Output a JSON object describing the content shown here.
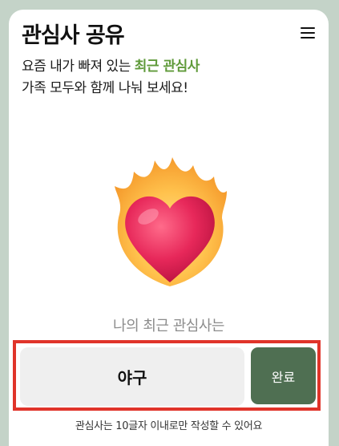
{
  "header": {
    "title": "관심사 공유",
    "menu_icon": "hamburger-menu-icon"
  },
  "intro": {
    "line1_prefix": "요즘 내가 빠져 있는 ",
    "line1_highlight": "최근 관심사",
    "line2": "가족 모두와 함께 나눠 보세요!"
  },
  "illustration": {
    "icon": "heart-on-fire-icon"
  },
  "form": {
    "caption": "나의 최근 관심사는",
    "input_value": "야구",
    "done_label": "완료",
    "hint": "관심사는 10글자 이내로만 작성할 수 있어요"
  },
  "colors": {
    "highlight": "#5f9a3a",
    "done_button": "#4f6f52",
    "focus_border": "#e0342a",
    "frame_background": "#c4d3c8"
  }
}
